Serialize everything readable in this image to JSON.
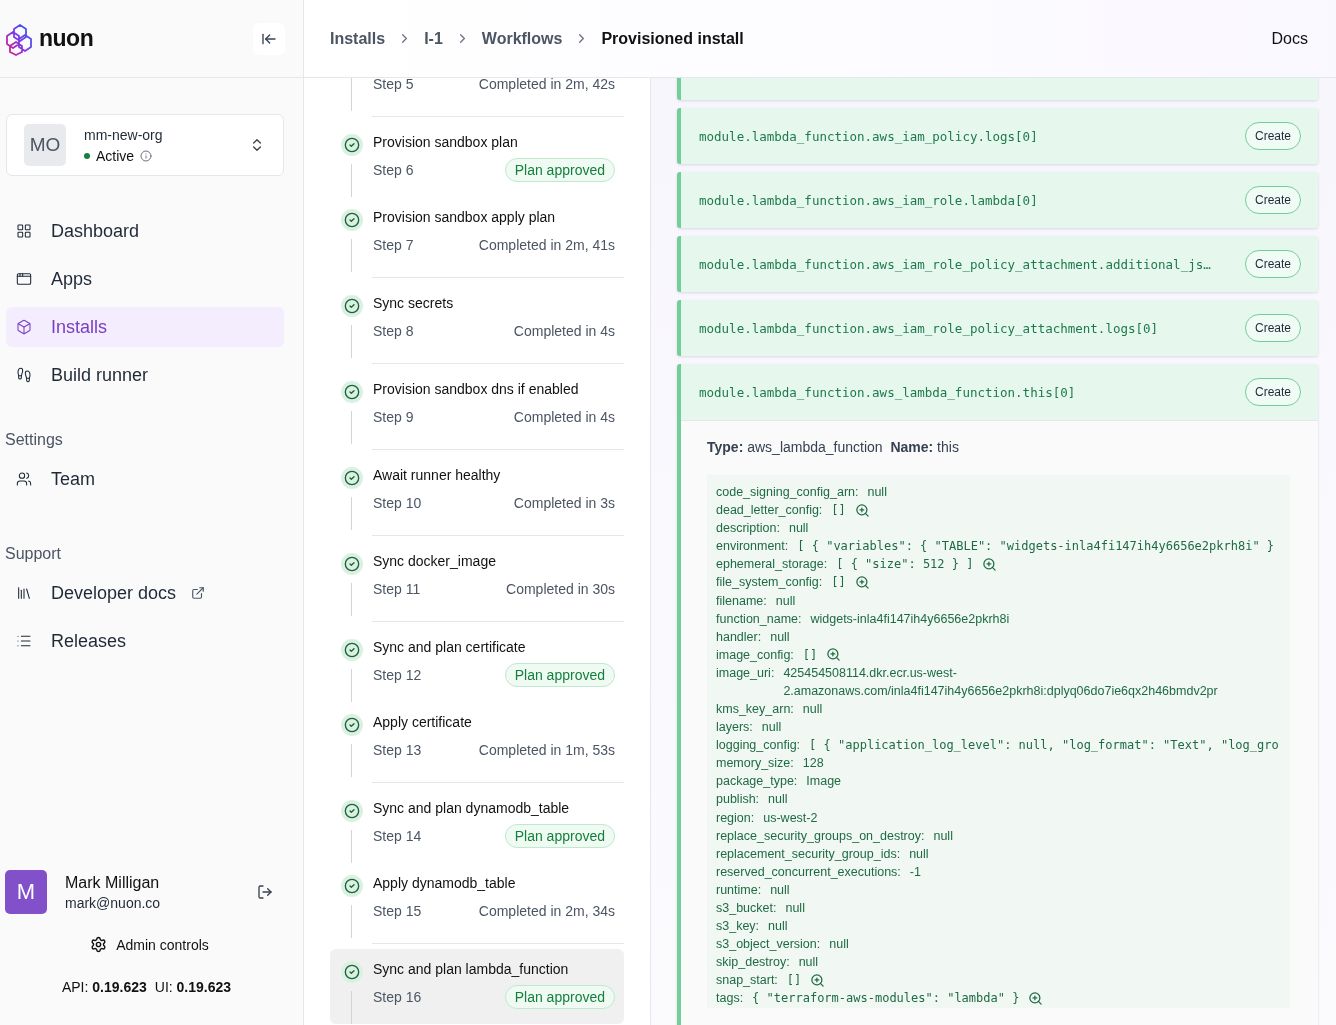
{
  "brand": {
    "name": "nuon"
  },
  "org": {
    "initials": "MO",
    "name": "mm-new-org",
    "status": "Active"
  },
  "nav": [
    {
      "label": "Dashboard",
      "selected": false
    },
    {
      "label": "Apps",
      "selected": false
    },
    {
      "label": "Installs",
      "selected": true
    },
    {
      "label": "Build runner",
      "selected": false
    }
  ],
  "settings": {
    "heading": "Settings",
    "items": [
      {
        "label": "Team"
      }
    ]
  },
  "support": {
    "heading": "Support",
    "items": [
      {
        "label": "Developer docs",
        "external": true
      },
      {
        "label": "Releases",
        "external": false
      }
    ]
  },
  "user": {
    "initials": "M",
    "name": "Mark Milligan",
    "email": "mark@nuon.co"
  },
  "admin_controls": "Admin controls",
  "versions": [
    {
      "label": "API:",
      "value": "0.19.623"
    },
    {
      "label": "UI:",
      "value": "0.19.623"
    }
  ],
  "breadcrumbs": [
    {
      "label": "Installs",
      "current": false
    },
    {
      "label": "I-1",
      "current": false
    },
    {
      "label": "Workflows",
      "current": false
    },
    {
      "label": "Provisioned install",
      "current": true
    }
  ],
  "docs_link": "Docs",
  "steps": [
    {
      "step": "Step 5",
      "kind": "completed",
      "status": "Completed in 2m, 42s",
      "selected": false
    },
    {
      "title": "Provision sandbox plan",
      "step": "Step 6",
      "kind": "approved",
      "status": "Plan approved",
      "selected": false
    },
    {
      "title": "Provision sandbox apply plan",
      "step": "Step 7",
      "kind": "completed",
      "status": "Completed in 2m, 41s",
      "selected": false
    },
    {
      "title": "Sync secrets",
      "step": "Step 8",
      "kind": "completed",
      "status": "Completed in 4s",
      "selected": false
    },
    {
      "title": "Provision sandbox dns if enabled",
      "step": "Step 9",
      "kind": "completed",
      "status": "Completed in 4s",
      "selected": false
    },
    {
      "title": "Await runner healthy",
      "step": "Step 10",
      "kind": "completed",
      "status": "Completed in 3s",
      "selected": false
    },
    {
      "title": "Sync docker_image",
      "step": "Step 11",
      "kind": "completed",
      "status": "Completed in 30s",
      "selected": false
    },
    {
      "title": "Sync and plan certificate",
      "step": "Step 12",
      "kind": "approved",
      "status": "Plan approved",
      "selected": false
    },
    {
      "title": "Apply certificate",
      "step": "Step 13",
      "kind": "completed",
      "status": "Completed in 1m, 53s",
      "selected": false
    },
    {
      "title": "Sync and plan dynamodb_table",
      "step": "Step 14",
      "kind": "approved",
      "status": "Plan approved",
      "selected": false
    },
    {
      "title": "Apply dynamodb_table",
      "step": "Step 15",
      "kind": "completed",
      "status": "Completed in 2m, 34s",
      "selected": false
    },
    {
      "title": "Sync and plan lambda_function",
      "step": "Step 16",
      "kind": "approved",
      "status": "Plan approved",
      "selected": true
    }
  ],
  "resources": [
    {
      "address": "module.lambda_function.aws_iam_policy.logs[0]",
      "action": "Create",
      "expanded": false
    },
    {
      "address": "module.lambda_function.aws_iam_role.lambda[0]",
      "action": "Create",
      "expanded": false
    },
    {
      "address": "module.lambda_function.aws_iam_role_policy_attachment.additional_js…",
      "action": "Create",
      "expanded": false
    },
    {
      "address": "module.lambda_function.aws_iam_role_policy_attachment.logs[0]",
      "action": "Create",
      "expanded": false
    },
    {
      "address": "module.lambda_function.aws_lambda_function.this[0]",
      "action": "Create",
      "expanded": true,
      "details": {
        "type_label": "Type:",
        "type": "aws_lambda_function",
        "name_label": "Name:",
        "name": "this",
        "attributes": [
          {
            "key": "code_signing_config_arn:",
            "value": "null",
            "kind": "text",
            "zoom": false
          },
          {
            "key": "dead_letter_config:",
            "value": "[]",
            "kind": "code",
            "zoom": true
          },
          {
            "key": "description:",
            "value": "null",
            "kind": "text",
            "zoom": false
          },
          {
            "key": "environment:",
            "value": "[ { \"variables\": { \"TABLE\": \"widgets-inla4fi147ih4y6656e2pkrh8i\" }",
            "kind": "code",
            "zoom": false
          },
          {
            "key": "ephemeral_storage:",
            "value": "[ { \"size\": 512 } ]",
            "kind": "code",
            "zoom": true
          },
          {
            "key": "file_system_config:",
            "value": "[]",
            "kind": "code",
            "zoom": true
          },
          {
            "key": "filename:",
            "value": "null",
            "kind": "text",
            "zoom": false
          },
          {
            "key": "function_name:",
            "value": "widgets-inla4fi147ih4y6656e2pkrh8i",
            "kind": "text",
            "zoom": false
          },
          {
            "key": "handler:",
            "value": "null",
            "kind": "text",
            "zoom": false
          },
          {
            "key": "image_config:",
            "value": "[]",
            "kind": "code",
            "zoom": true
          },
          {
            "key": "image_uri:",
            "value": "425454508114.dkr.ecr.us-west-2.amazonaws.com/inla4fi147ih4y6656e2pkrh8i:dplyq06do7ie6qx2h46bmdv2pr",
            "kind": "text",
            "zoom": false
          },
          {
            "key": "kms_key_arn:",
            "value": "null",
            "kind": "text",
            "zoom": false
          },
          {
            "key": "layers:",
            "value": "null",
            "kind": "text",
            "zoom": false
          },
          {
            "key": "logging_config:",
            "value": "[ { \"application_log_level\": null, \"log_format\": \"Text\", \"log_gro",
            "kind": "code",
            "zoom": false
          },
          {
            "key": "memory_size:",
            "value": "128",
            "kind": "text",
            "zoom": false
          },
          {
            "key": "package_type:",
            "value": "Image",
            "kind": "text",
            "zoom": false
          },
          {
            "key": "publish:",
            "value": "null",
            "kind": "text",
            "zoom": false
          },
          {
            "key": "region:",
            "value": "us-west-2",
            "kind": "text",
            "zoom": false
          },
          {
            "key": "replace_security_groups_on_destroy:",
            "value": "null",
            "kind": "text",
            "zoom": false
          },
          {
            "key": "replacement_security_group_ids:",
            "value": "null",
            "kind": "text",
            "zoom": false
          },
          {
            "key": "reserved_concurrent_executions:",
            "value": "-1",
            "kind": "text",
            "zoom": false
          },
          {
            "key": "runtime:",
            "value": "null",
            "kind": "text",
            "zoom": false
          },
          {
            "key": "s3_bucket:",
            "value": "null",
            "kind": "text",
            "zoom": false
          },
          {
            "key": "s3_key:",
            "value": "null",
            "kind": "text",
            "zoom": false
          },
          {
            "key": "s3_object_version:",
            "value": "null",
            "kind": "text",
            "zoom": false
          },
          {
            "key": "skip_destroy:",
            "value": "null",
            "kind": "text",
            "zoom": false
          },
          {
            "key": "snap_start:",
            "value": "[]",
            "kind": "code",
            "zoom": true
          },
          {
            "key": "tags:",
            "value": "{ \"terraform-aws-modules\": \"lambda\" }",
            "kind": "code",
            "zoom": true
          }
        ]
      }
    }
  ]
}
